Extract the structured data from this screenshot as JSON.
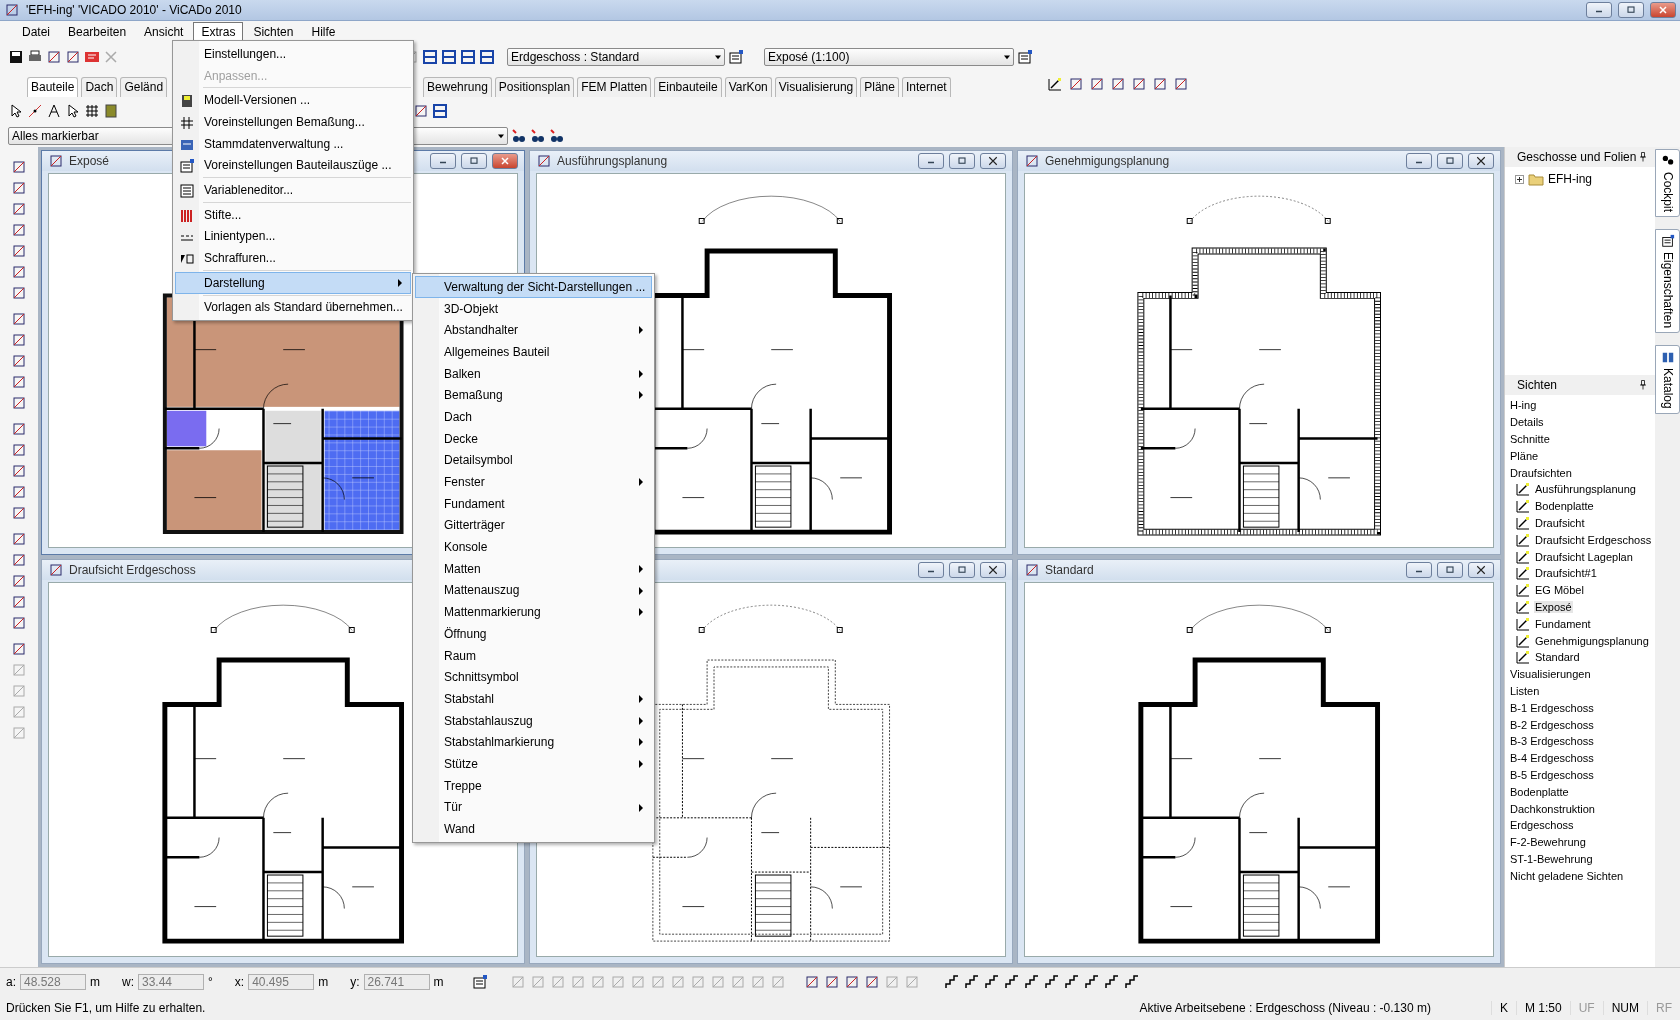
{
  "window": {
    "title": "'EFH-ing' 'VICADO 2010' - ViCADo 2010"
  },
  "menu_bar": [
    {
      "label": "Datei",
      "selected": false
    },
    {
      "label": "Bearbeiten",
      "selected": false
    },
    {
      "label": "Ansicht",
      "selected": false
    },
    {
      "label": "Extras",
      "selected": true
    },
    {
      "label": "Sichten",
      "selected": false
    },
    {
      "label": "Hilfe",
      "selected": false
    }
  ],
  "toolbar": {
    "storey_select": "Erdgeschoss : Standard",
    "view_select": "Exposé (1:100)"
  },
  "ribbon_tabs": [
    {
      "label": "Bauteile",
      "selected": true
    },
    {
      "label": "Dach",
      "selected": false
    },
    {
      "label": "Geländ",
      "selected": false
    },
    {
      "label": "Bewehrung",
      "selected": false
    },
    {
      "label": "Positionsplan",
      "selected": false
    },
    {
      "label": "FEM Platten",
      "selected": false
    },
    {
      "label": "Einbauteile",
      "selected": false
    },
    {
      "label": "VarKon",
      "selected": false
    },
    {
      "label": "Visualisierung",
      "selected": false
    },
    {
      "label": "Pläne",
      "selected": false
    },
    {
      "label": "Internet",
      "selected": false
    }
  ],
  "filter_select": "Alles markierbar",
  "view_windows": [
    {
      "title": "Exposé",
      "active": true,
      "kind": "colored"
    },
    {
      "title": "Ausführungsplanung",
      "active": false,
      "kind": "solid"
    },
    {
      "title": "Genehmigungsplanung",
      "active": false,
      "kind": "hatched"
    },
    {
      "title": "Draufsicht Erdgeschoss",
      "active": false,
      "kind": "solid"
    },
    {
      "active": false,
      "kind": "dashed"
    },
    {
      "title": "Standard",
      "active": false,
      "kind": "solid"
    }
  ],
  "floors_panel": {
    "title": "Geschosse und Folien",
    "tree": [
      {
        "label": "EFH-ing",
        "expanded": false
      }
    ]
  },
  "views_panel": {
    "title": "Sichten",
    "items": [
      {
        "label": "H-ing",
        "selected": false
      },
      {
        "label": "Details",
        "selected": false
      },
      {
        "label": "Schnitte",
        "selected": false
      },
      {
        "label": "Pläne",
        "selected": false
      },
      {
        "label": "Draufsichten",
        "selected": false,
        "children": [
          {
            "label": "Ausführungsplanung",
            "selected": false
          },
          {
            "label": "Bodenplatte",
            "selected": false
          },
          {
            "label": "Draufsicht",
            "selected": false
          },
          {
            "label": "Draufsicht Erdgeschoss",
            "selected": false
          },
          {
            "label": "Draufsicht Lageplan",
            "selected": false
          },
          {
            "label": "Draufsicht#1",
            "selected": false
          },
          {
            "label": "EG Möbel",
            "selected": false
          },
          {
            "label": "Exposé",
            "selected": true
          },
          {
            "label": "Fundament",
            "selected": false
          },
          {
            "label": "Genehmigungsplanung",
            "selected": false
          },
          {
            "label": "Standard",
            "selected": false
          }
        ]
      },
      {
        "label": "Visualisierungen",
        "selected": false
      },
      {
        "label": "Listen",
        "selected": false
      },
      {
        "label": "B-1 Erdgeschoss",
        "selected": false
      },
      {
        "label": "B-2 Erdgeschoss",
        "selected": false
      },
      {
        "label": "B-3 Erdgeschoss",
        "selected": false
      },
      {
        "label": "B-4 Erdgeschoss",
        "selected": false
      },
      {
        "label": "B-5 Erdgeschoss",
        "selected": false
      },
      {
        "label": "Bodenplatte",
        "selected": false
      },
      {
        "label": "Dachkonstruktion",
        "selected": false
      },
      {
        "label": "Erdgeschoss",
        "selected": false
      },
      {
        "label": "F-2-Bewehrung",
        "selected": false
      },
      {
        "label": "ST-1-Bewehrung",
        "selected": false
      },
      {
        "label": "Nicht geladene Sichten",
        "selected": false
      }
    ]
  },
  "side_tabs": [
    "Cockpit",
    "Eigenschaften",
    "Katalog"
  ],
  "extras_menu": [
    {
      "kind": "item",
      "label": "Einstellungen...",
      "disabled": false,
      "highlighted": false
    },
    {
      "kind": "item",
      "label": "Anpassen...",
      "disabled": true,
      "highlighted": false
    },
    {
      "kind": "separator"
    },
    {
      "kind": "item",
      "label": "Modell-Versionen ...",
      "disabled": false,
      "highlighted": false
    },
    {
      "kind": "item",
      "label": "Voreinstellungen Bemaßung...",
      "disabled": false,
      "highlighted": false
    },
    {
      "kind": "item",
      "label": "Stammdatenverwaltung ...",
      "disabled": false,
      "highlighted": false
    },
    {
      "kind": "item",
      "label": "Voreinstellungen Bauteilauszüge ...",
      "disabled": false,
      "highlighted": false
    },
    {
      "kind": "separator"
    },
    {
      "kind": "item",
      "label": "Variableneditor...",
      "disabled": false,
      "highlighted": false
    },
    {
      "kind": "separator"
    },
    {
      "kind": "item",
      "label": "Stifte...",
      "disabled": false,
      "highlighted": false
    },
    {
      "kind": "item",
      "label": "Linientypen...",
      "disabled": false,
      "highlighted": false
    },
    {
      "kind": "item",
      "label": "Schraffuren...",
      "disabled": false,
      "highlighted": false
    },
    {
      "kind": "separator"
    },
    {
      "kind": "submenu",
      "label": "Darstellung",
      "disabled": false,
      "highlighted": true
    },
    {
      "kind": "separator"
    },
    {
      "kind": "item",
      "label": "Vorlagen als Standard übernehmen...",
      "disabled": false,
      "highlighted": false
    }
  ],
  "display_submenu": [
    {
      "label": "Verwaltung der Sicht-Darstellungen ...",
      "highlighted": true,
      "has_submenu": false
    },
    {
      "label": "3D-Objekt",
      "highlighted": false,
      "has_submenu": false
    },
    {
      "label": "Abstandhalter",
      "highlighted": false,
      "has_submenu": true
    },
    {
      "label": "Allgemeines Bauteil",
      "highlighted": false,
      "has_submenu": false
    },
    {
      "label": "Balken",
      "highlighted": false,
      "has_submenu": true
    },
    {
      "label": "Bemaßung",
      "highlighted": false,
      "has_submenu": true
    },
    {
      "label": "Dach",
      "highlighted": false,
      "has_submenu": false
    },
    {
      "label": "Decke",
      "highlighted": false,
      "has_submenu": false
    },
    {
      "label": "Detailsymbol",
      "highlighted": false,
      "has_submenu": false
    },
    {
      "label": "Fenster",
      "highlighted": false,
      "has_submenu": true
    },
    {
      "label": "Fundament",
      "highlighted": false,
      "has_submenu": false
    },
    {
      "label": "Gitterträger",
      "highlighted": false,
      "has_submenu": false
    },
    {
      "label": "Konsole",
      "highlighted": false,
      "has_submenu": false
    },
    {
      "label": "Matten",
      "highlighted": false,
      "has_submenu": true
    },
    {
      "label": "Mattenauszug",
      "highlighted": false,
      "has_submenu": true
    },
    {
      "label": "Mattenmarkierung",
      "highlighted": false,
      "has_submenu": true
    },
    {
      "label": "Öffnung",
      "highlighted": false,
      "has_submenu": false
    },
    {
      "label": "Raum",
      "highlighted": false,
      "has_submenu": false
    },
    {
      "label": "Schnittsymbol",
      "highlighted": false,
      "has_submenu": false
    },
    {
      "label": "Stabstahl",
      "highlighted": false,
      "has_submenu": true
    },
    {
      "label": "Stabstahlauszug",
      "highlighted": false,
      "has_submenu": true
    },
    {
      "label": "Stabstahlmarkierung",
      "highlighted": false,
      "has_submenu": true
    },
    {
      "label": "Stütze",
      "highlighted": false,
      "has_submenu": true
    },
    {
      "label": "Treppe",
      "highlighted": false,
      "has_submenu": false
    },
    {
      "label": "Tür",
      "highlighted": false,
      "has_submenu": true
    },
    {
      "label": "Wand",
      "highlighted": false,
      "has_submenu": false
    }
  ],
  "coordinates": [
    {
      "label": "a:",
      "value": "48.528",
      "unit": "m"
    },
    {
      "label": "w:",
      "value": "33.44",
      "unit": "°"
    },
    {
      "label": "x:",
      "value": "40.495",
      "unit": "m"
    },
    {
      "label": "y:",
      "value": "26.741",
      "unit": "m"
    }
  ],
  "status_bar": {
    "hint": "Drücken Sie F1, um Hilfe zu erhalten.",
    "work_plane": "Aktive Arbeitsebene : Erdgeschoss (Niveau : -0.130 m)",
    "indicators": [
      {
        "label": "K",
        "active": true
      },
      {
        "label": "M 1:50",
        "active": true
      },
      {
        "label": "UF",
        "active": false
      },
      {
        "label": "NUM",
        "active": true
      },
      {
        "label": "RF",
        "active": false
      }
    ]
  }
}
